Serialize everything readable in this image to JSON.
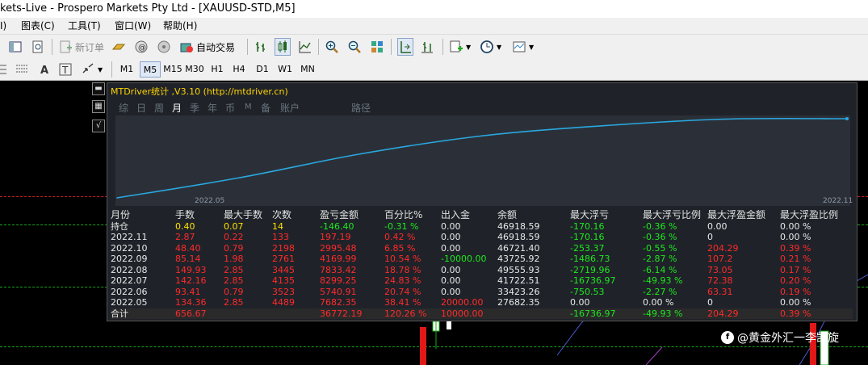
{
  "window": {
    "title": "kets-Live - Prospero Markets Pty Ltd - [XAUUSD-STD,M5]"
  },
  "menu": [
    "I)",
    "图表(C)",
    "工具(T)",
    "窗口(W)",
    "帮助(H)"
  ],
  "toolbar": {
    "new_order": "新订单",
    "auto_trade": "自动交易"
  },
  "timeframes": [
    "M1",
    "M5",
    "M15",
    "M30",
    "H1",
    "H4",
    "D1",
    "W1",
    "MN"
  ],
  "active_timeframe": "M5",
  "panel": {
    "title": "MTDriver统计 ,V3.10 (http://mtdriver.cn)",
    "tabs": [
      "综",
      "日",
      "周",
      "月",
      "季",
      "年",
      "币",
      "M",
      "备",
      "账户",
      "路径"
    ],
    "active_tab": "月",
    "x_start_label": "2022.05",
    "x_end_label": "2022.11"
  },
  "chart_data": {
    "type": "line",
    "x": [
      "2022.05",
      "2022.06",
      "2022.07",
      "2022.08",
      "2022.09",
      "2022.10",
      "2022.11"
    ],
    "series": [
      {
        "values": [
          0.0,
          20.74,
          45.57,
          64.35,
          74.89,
          81.74,
          82.16
        ]
      }
    ],
    "ylim": [
      0,
      82.16
    ]
  },
  "table": {
    "headers": [
      "月份",
      "手数",
      "最大手数",
      "次数",
      "盈亏金额",
      "百分比%",
      "出入金",
      "余额",
      "最大浮亏",
      "最大浮亏比例",
      "最大浮盈金额",
      "最大浮盈比例"
    ],
    "rows": [
      {
        "kind": "hold",
        "cells": [
          "持仓",
          "0.40",
          "0.07",
          "14",
          "-146.40",
          "-0.31 %",
          "0.00",
          "46918.59",
          "-170.16",
          "-0.36 %",
          "0.00",
          "0.00 %"
        ]
      },
      {
        "kind": "month",
        "cells": [
          "2022.11",
          "2.87",
          "0.22",
          "133",
          "197.19",
          "0.42 %",
          "0.00",
          "46918.59",
          "-170.16",
          "-0.36 %",
          "0",
          "0.00 %"
        ]
      },
      {
        "kind": "month",
        "cells": [
          "2022.10",
          "48.40",
          "0.79",
          "2198",
          "2995.48",
          "6.85 %",
          "0.00",
          "46721.40",
          "-253.37",
          "-0.55 %",
          "204.29",
          "0.39 %"
        ]
      },
      {
        "kind": "month",
        "cells": [
          "2022.09",
          "85.14",
          "1.98",
          "2761",
          "4169.99",
          "10.54 %",
          "-10000.00",
          "43725.92",
          "-1486.73",
          "-2.87 %",
          "107.2",
          "0.21 %"
        ]
      },
      {
        "kind": "month",
        "cells": [
          "2022.08",
          "149.93",
          "2.85",
          "3445",
          "7833.42",
          "18.78 %",
          "0.00",
          "49555.93",
          "-2719.96",
          "-6.14 %",
          "73.05",
          "0.17 %"
        ]
      },
      {
        "kind": "month",
        "cells": [
          "2022.07",
          "142.16",
          "2.85",
          "4135",
          "8299.25",
          "24.83 %",
          "0.00",
          "41722.51",
          "-16736.97",
          "-49.93 %",
          "72.38",
          "0.20 %"
        ]
      },
      {
        "kind": "month",
        "cells": [
          "2022.06",
          "93.41",
          "0.79",
          "3523",
          "5740.91",
          "20.74 %",
          "0.00",
          "33423.26",
          "-750.53",
          "-2.27 %",
          "63.31",
          "0.19 %"
        ]
      },
      {
        "kind": "month",
        "cells": [
          "2022.05",
          "134.36",
          "2.85",
          "4489",
          "7682.35",
          "38.41 %",
          "20000.00",
          "27682.35",
          "0.00",
          "0.00 %",
          "0",
          "0.00 %"
        ]
      },
      {
        "kind": "total",
        "cells": [
          "合计",
          "656.67",
          "",
          "",
          "36772.19",
          "120.26 %",
          "10000.00",
          "",
          "-16736.97",
          "-49.93 %",
          "204.29",
          "0.39 %"
        ]
      }
    ]
  },
  "watermark": "@黄金外汇一李凯旋",
  "colors": {
    "panel_bg": "#1f2329",
    "curve": "#29a8e0",
    "title": "#ffd400",
    "positive": "#1ee81e",
    "negative": "#ff2a2a"
  }
}
